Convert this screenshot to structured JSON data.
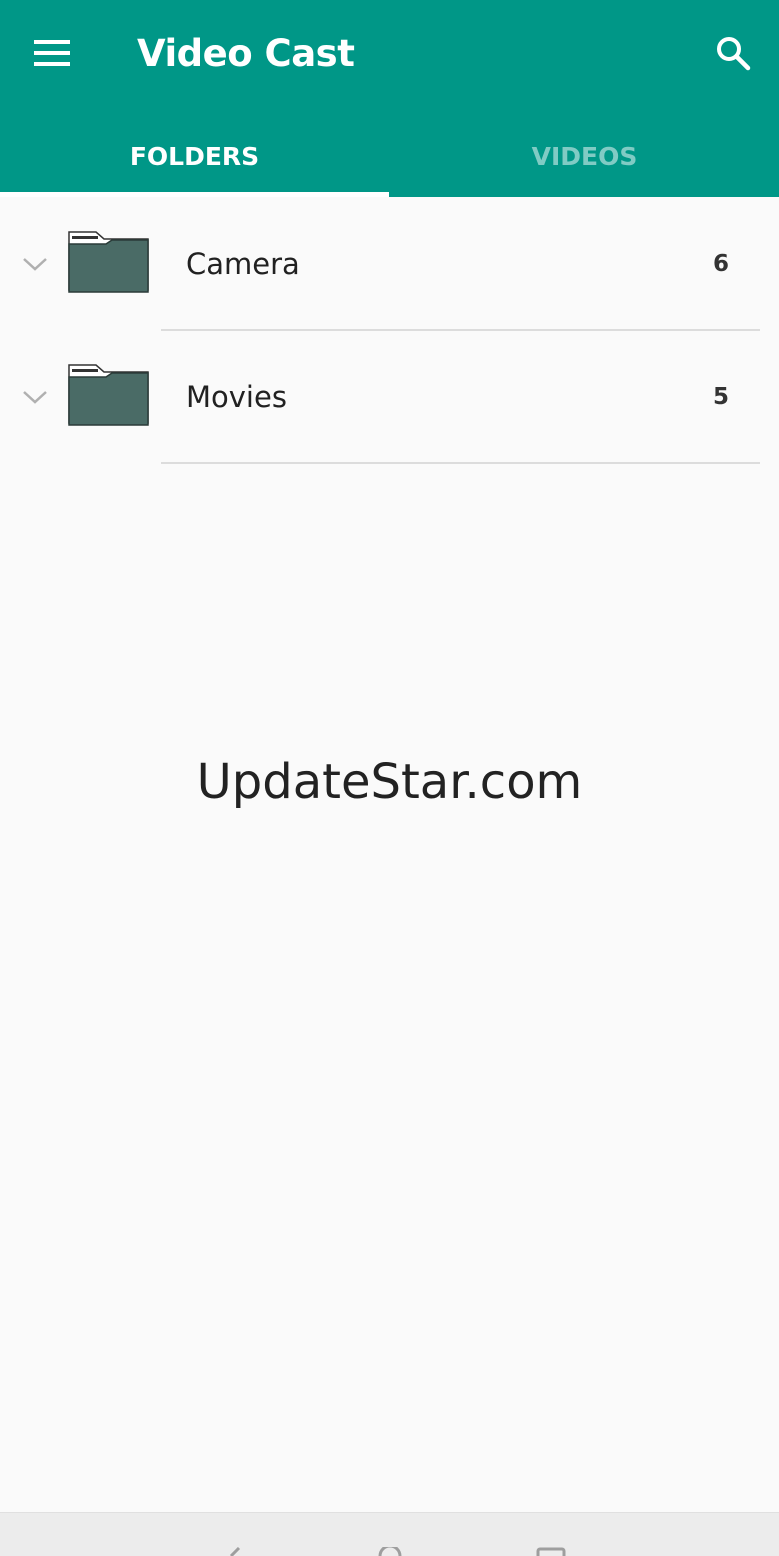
{
  "app": {
    "title": "Video Cast",
    "menu_icon": "hamburger-menu-icon",
    "search_icon": "search-icon",
    "primary_color": "#009787",
    "inactive_tab_color": "#80cbc4"
  },
  "tabs": [
    {
      "label": "FOLDERS",
      "selected": true
    },
    {
      "label": "VIDEOS",
      "selected": false
    }
  ],
  "folders": [
    {
      "name": "Camera",
      "count": "6",
      "icon": "folder-icon",
      "expand_icon": "chevron-down-icon"
    },
    {
      "name": "Movies",
      "count": "5",
      "icon": "folder-icon",
      "expand_icon": "chevron-down-icon"
    }
  ],
  "watermark": "UpdateStar.com",
  "system_nav": {
    "icons": [
      "back-icon",
      "home-icon",
      "recent-apps-icon"
    ]
  }
}
